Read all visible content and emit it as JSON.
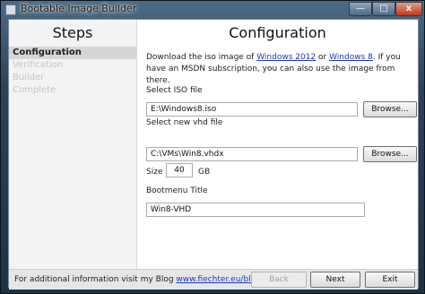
{
  "window": {
    "title": "Bootable Image Builder",
    "controls": {
      "minimize": "—",
      "maximize": "□",
      "close": "x"
    }
  },
  "sidebar": {
    "heading": "Steps",
    "items": [
      {
        "label": "Configuration",
        "state": "active"
      },
      {
        "label": "Verification",
        "state": "disabled"
      },
      {
        "label": "Builder",
        "state": "disabled"
      },
      {
        "label": "Complete",
        "state": "disabled"
      }
    ]
  },
  "main": {
    "heading": "Configuration",
    "description": {
      "part1": "Download the iso image of ",
      "link1": "Windows 2012",
      "part2": " or ",
      "link2": "Windows 8",
      "part3": ". If you have an MSDN subscription, you can also use the image from there."
    },
    "iso": {
      "label": "Select ISO file",
      "value": "E:\\Windows8.iso",
      "browse_label": "Browse..."
    },
    "vhd": {
      "label": "Select new vhd file",
      "value": "C:\\VMs\\Win8.vhdx",
      "browse_label": "Browse..."
    },
    "size": {
      "label": "Size",
      "value": "40",
      "unit": "GB"
    },
    "bootmenu": {
      "label": "Bootmenu Title",
      "value": "Win8-VHD"
    }
  },
  "footer": {
    "info_text": "For additional information visit my Blog ",
    "blog_link": "www.fiechter.eu/blog",
    "info_suffix": ".",
    "back_label": "Back",
    "next_label": "Next",
    "exit_label": "Exit"
  }
}
